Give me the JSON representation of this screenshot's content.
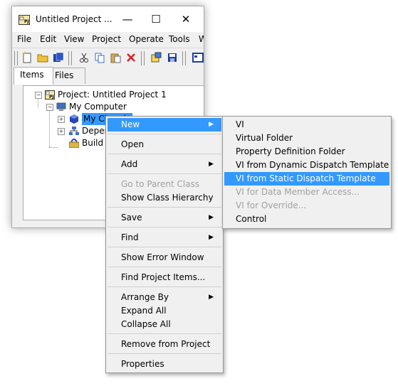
{
  "window": {
    "title": "Untitled Project ...",
    "minimize_glyph": "—",
    "maximize_glyph": "☐",
    "close_glyph": "✕"
  },
  "menubar": [
    "File",
    "Edit",
    "View",
    "Project",
    "Operate",
    "Tools",
    "W"
  ],
  "toolbar_icons": [
    "new-icon",
    "open-icon",
    "save-all-icon",
    "cut-icon",
    "copy-icon",
    "paste-icon",
    "delete-icon",
    "build-icon",
    "save-icon",
    "properties-icon"
  ],
  "tabs": [
    "Items",
    "Files"
  ],
  "tree": {
    "project": "Project: Untitled Project 1",
    "computer": "My Computer",
    "class": "My Class.lvclass",
    "class_visible": "My Class.lv",
    "dependencies": "Depende",
    "build": "Build Spe"
  },
  "context_menu": [
    {
      "label": "New",
      "submenu": true,
      "highlighted": true
    },
    {
      "label": "Open"
    },
    {
      "label": "Add",
      "submenu": true
    },
    {
      "label": "Go to Parent Class",
      "disabled": true
    },
    {
      "label": "Show Class Hierarchy"
    },
    {
      "label": "Save",
      "submenu": true
    },
    {
      "label": "Find",
      "submenu": true
    },
    {
      "label": "Show Error Window"
    },
    {
      "label": "Find Project Items..."
    },
    {
      "label": "Arrange By",
      "submenu": true
    },
    {
      "label": "Expand All"
    },
    {
      "label": "Collapse All"
    },
    {
      "label": "Remove from Project"
    },
    {
      "label": "Properties"
    }
  ],
  "new_submenu": [
    {
      "label": "VI"
    },
    {
      "label": "Virtual Folder"
    },
    {
      "label": "Property Definition Folder"
    },
    {
      "label": "VI from Dynamic Dispatch Template"
    },
    {
      "label": "VI from Static Dispatch Template",
      "highlighted": true
    },
    {
      "label": "VI for Data Member Access...",
      "disabled": true
    },
    {
      "label": "VI for Override...",
      "disabled": true
    },
    {
      "label": "Control"
    }
  ],
  "colors": {
    "highlight": "#3399ff",
    "disabled_text": "#a0a0a0",
    "menu_bg": "#f0f0f0"
  }
}
